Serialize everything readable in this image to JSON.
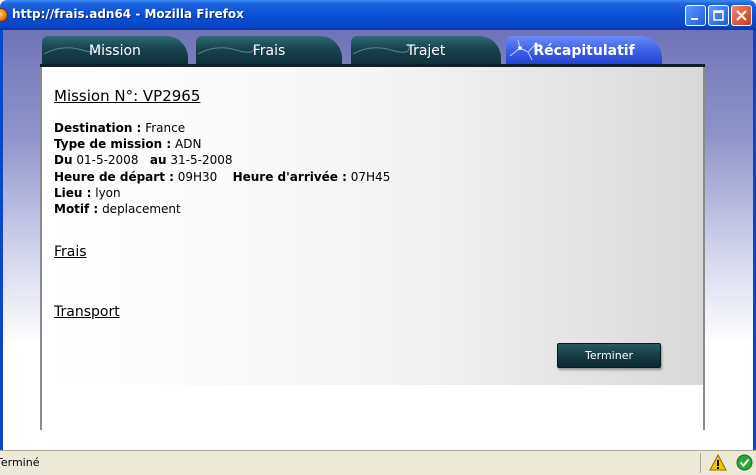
{
  "window": {
    "title": "http://frais.adn64 - Mozilla Firefox"
  },
  "tabs": [
    {
      "label": "Mission"
    },
    {
      "label": "Frais"
    },
    {
      "label": "Trajet"
    },
    {
      "label": "Récapitulatif"
    }
  ],
  "mission": {
    "title": "Mission N°: VP2965",
    "destination_label": "Destination :",
    "destination_value": "France",
    "type_label": "Type de mission :",
    "type_value": "ADN",
    "du_label": "Du",
    "du_value": "01-5-2008",
    "au_label": "au",
    "au_value": "31-5-2008",
    "depart_label": "Heure de départ :",
    "depart_value": "09H30",
    "arrivee_label": "Heure d'arrivée :",
    "arrivee_value": "07H45",
    "lieu_label": "Lieu :",
    "lieu_value": "lyon",
    "motif_label": "Motif :",
    "motif_value": "deplacement"
  },
  "sections": {
    "frais": "Frais",
    "transport": "Transport"
  },
  "buttons": {
    "terminer": "Terminer"
  },
  "statusbar": {
    "text": "Terminé"
  },
  "colors": {
    "titlebar": "#0b4fd6",
    "tab": "#184450",
    "tab_active": "#3f62e8",
    "button": "#133a40"
  }
}
